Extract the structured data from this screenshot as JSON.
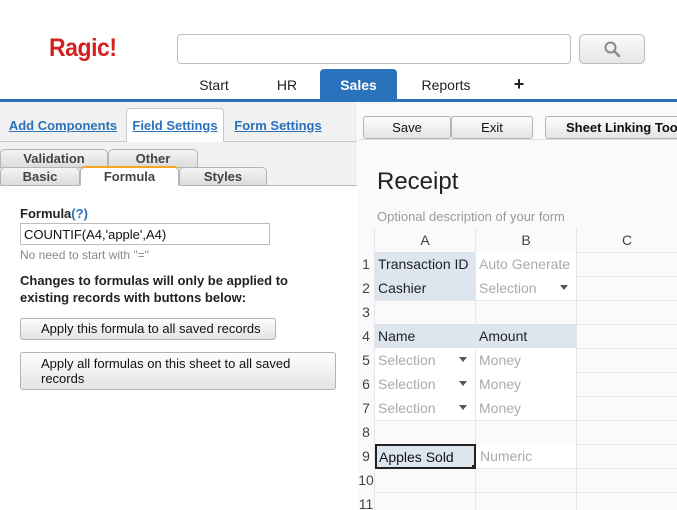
{
  "app": {
    "logo": "Ragic!"
  },
  "search": {
    "value": "",
    "placeholder": ""
  },
  "tabs": [
    "Start",
    "HR",
    "Sales",
    "Reports",
    "+"
  ],
  "active_tab": "Sales",
  "panel_tabs": [
    "Add Components",
    "Field Settings",
    "Form Settings"
  ],
  "active_panel_tab": "Field Settings",
  "sub_tabs": {
    "row1": [
      "Validation",
      "Other"
    ],
    "row2": [
      "Basic",
      "Formula",
      "Styles"
    ],
    "active": "Formula"
  },
  "formula": {
    "label": "Formula",
    "help": "(?)",
    "value": "COUNTIF(A4,'apple',A4)",
    "hint": "No need to start with \"=\"",
    "note": "Changes to formulas will only be applied to existing records with buttons below:",
    "apply_one_label": "Apply this formula to all saved records",
    "apply_all_label": "Apply all formulas on this sheet to all saved records"
  },
  "toolbar": {
    "save_label": "Save",
    "exit_label": "Exit",
    "sheet_linking_label": "Sheet Linking Tools"
  },
  "form": {
    "title": "Receipt",
    "description": "Optional description of your form"
  },
  "sheet": {
    "columns": [
      "A",
      "B",
      "C"
    ],
    "rows": [
      "1",
      "2",
      "3",
      "4",
      "5",
      "6",
      "7",
      "8",
      "9",
      "10",
      "11"
    ],
    "cells": {
      "a1": "Transaction ID",
      "b1": "Auto Generate",
      "a2": "Cashier",
      "b2": "Selection",
      "a4": "Name",
      "b4": "Amount",
      "a5": "Selection",
      "b5": "Money",
      "a6": "Selection",
      "b6": "Money",
      "a7": "Selection",
      "b7": "Money",
      "a9": "Apples Sold",
      "b9": "Numeric"
    }
  },
  "colors": {
    "brand_red": "#d62020",
    "accent_blue": "#2a72bc",
    "active_subtab": "#f5a623",
    "label_cell": "#dde6ef"
  },
  "icons": {
    "search": "search-icon",
    "dropdown": "chevron-down-icon"
  }
}
